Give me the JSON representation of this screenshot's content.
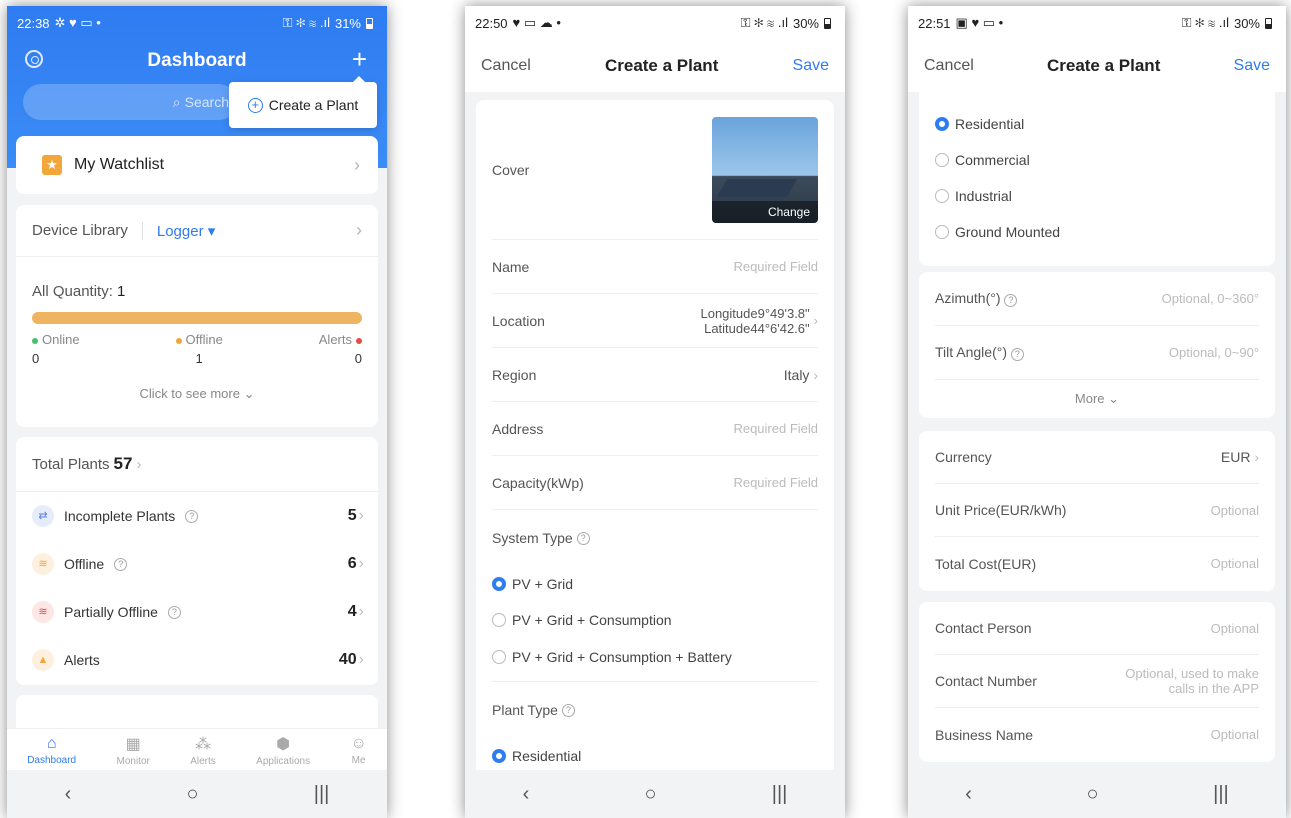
{
  "phone1": {
    "status": {
      "time": "22:38",
      "battery": "31%"
    },
    "title": "Dashboard",
    "search_placeholder": "Search",
    "popup_label": "Create a Plant",
    "watchlist": "My Watchlist",
    "device_library": {
      "label": "Device Library",
      "filter": "Logger"
    },
    "all_quantity_label": "All Quantity:",
    "all_quantity_value": "1",
    "online": {
      "label": "Online",
      "count": "0",
      "color": "#43c26a"
    },
    "offline": {
      "label": "Offline",
      "count": "1",
      "color": "#f3a73b"
    },
    "alerts": {
      "label": "Alerts",
      "count": "0",
      "color": "#e94b4b"
    },
    "click_more": "Click to see more",
    "total_plants_label": "Total Plants",
    "total_plants_value": "57",
    "rows": [
      {
        "label": "Incomplete Plants",
        "value": "5"
      },
      {
        "label": "Offline",
        "value": "6"
      },
      {
        "label": "Partially Offline",
        "value": "4"
      },
      {
        "label": "Alerts",
        "value": "40"
      }
    ],
    "tabs": [
      "Dashboard",
      "Monitor",
      "Alerts",
      "Applications",
      "Me"
    ]
  },
  "phone2": {
    "status": {
      "time": "22:50",
      "battery": "30%"
    },
    "cancel": "Cancel",
    "title": "Create a Plant",
    "save": "Save",
    "cover_label": "Cover",
    "change": "Change",
    "name_label": "Name",
    "required": "Required Field",
    "location_label": "Location",
    "longitude": "Longitude9°49'3.8\"",
    "latitude": "Latitude44°6'42.6\"",
    "region_label": "Region",
    "region_value": "Italy",
    "address_label": "Address",
    "capacity_label": "Capacity(kWp)",
    "system_type_label": "System Type",
    "system_types": [
      "PV + Grid",
      "PV + Grid + Consumption",
      "PV + Grid + Consumption + Battery"
    ],
    "plant_type_label": "Plant Type",
    "plant_type_first": "Residential"
  },
  "phone3": {
    "status": {
      "time": "22:51",
      "battery": "30%"
    },
    "cancel": "Cancel",
    "title": "Create a Plant",
    "save": "Save",
    "plant_types": [
      "Residential",
      "Commercial",
      "Industrial",
      "Ground Mounted"
    ],
    "azimuth_label": "Azimuth(°)",
    "azimuth_hint": "Optional, 0~360°",
    "tilt_label": "Tilt Angle(°)",
    "tilt_hint": "Optional, 0~90°",
    "more": "More",
    "currency_label": "Currency",
    "currency_value": "EUR",
    "unit_price_label": "Unit Price(EUR/kWh)",
    "total_cost_label": "Total Cost(EUR)",
    "optional": "Optional",
    "contact_person_label": "Contact Person",
    "contact_number_label": "Contact Number",
    "contact_number_hint": "Optional, used to make calls in the APP",
    "business_name_label": "Business Name"
  }
}
